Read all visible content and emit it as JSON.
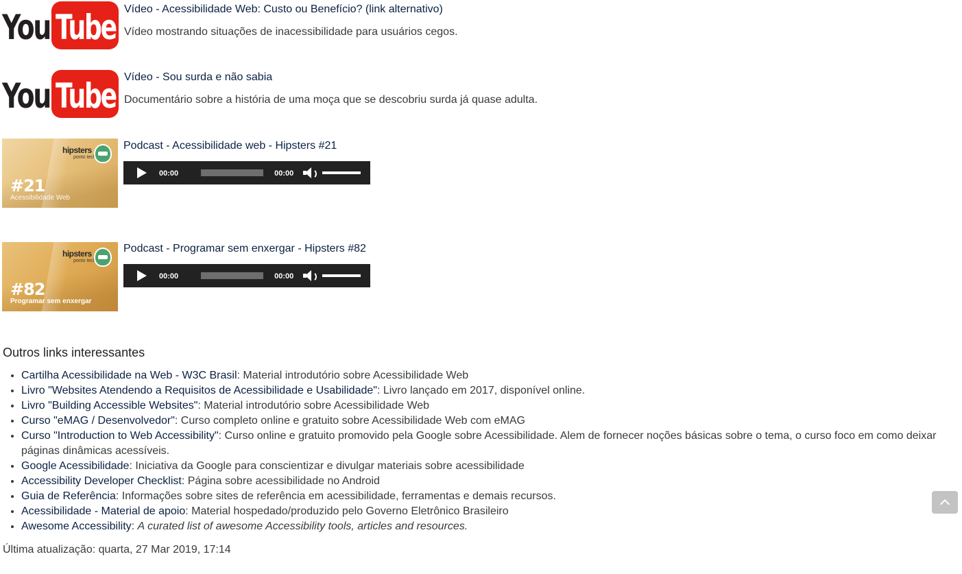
{
  "media": [
    {
      "type": "video",
      "thumb_icon": "youtube-logo",
      "title": "Vídeo - Acessibilidade Web: Custo ou Benefício? (link alternativo)",
      "description": "Vídeo mostrando situações de inacessibilidade para usuários cegos."
    },
    {
      "type": "video",
      "thumb_icon": "youtube-logo",
      "title": "Vídeo - Sou surda e não sabia",
      "description": "Documentário sobre a história de uma moça que se descobriu surda já quase adulta."
    },
    {
      "type": "podcast",
      "thumb_number": "#21",
      "thumb_subtitle": "Acessibilidade Web",
      "thumb_brand": "hipsters",
      "thumb_brand_sub": "ponto tech",
      "title": "Podcast - Acessibilidade web - Hipsters #21",
      "player": {
        "current_time": "00:00",
        "duration": "00:00"
      }
    },
    {
      "type": "podcast",
      "thumb_number": "#82",
      "thumb_subtitle": "Programar sem enxergar",
      "thumb_brand": "hipsters",
      "thumb_brand_sub": "ponto tech",
      "title": "Podcast - Programar sem enxergar - Hipsters #82",
      "player": {
        "current_time": "00:00",
        "duration": "00:00"
      }
    }
  ],
  "youtube_logo": {
    "word1": "You",
    "word2": "Tube",
    "red": "#e62117"
  },
  "links_section": {
    "heading": "Outros links interessantes",
    "items": [
      {
        "link": "Cartilha Acessibilidade na Web - W3C Brasil",
        "text": ": Material introdutório sobre Acessibilidade Web"
      },
      {
        "link": "Livro \"Websites Atendendo a Requisitos de Acessibilidade e Usabilidade\"",
        "text": ": Livro lançado em 2017, disponível online."
      },
      {
        "link": "Livro \"Building Accessible Websites\"",
        "text": ": Material introdutório sobre Acessibilidade Web"
      },
      {
        "link": "Curso \"eMAG / Desenvolvedor\"",
        "text": ": Curso completo online e gratuito sobre Acessibilidade Web com eMAG"
      },
      {
        "link": "Curso \"Introduction to Web Accessibility\"",
        "text": ": Curso online e gratuito promovido pela Google sobre Acessibilidade. Alem de fornecer noções básicas sobre o tema, o curso foco em como deixar páginas dinâmicas acessíveis."
      },
      {
        "link": "Google Acessibilidade",
        "text": ": Iniciativa da Google para conscientizar e divulgar materiais sobre acessibilidade"
      },
      {
        "link": "Accessibility Developer Checklist",
        "text": ": Página sobre acessibilidade no Android"
      },
      {
        "link": "Guia de Referência",
        "text": ": Informações sobre sites de referência em acessibilidade, ferramentas e demais recursos."
      },
      {
        "link": "Acessibilidade - Material de apoio",
        "text": ": Material hospedado/produzido pelo Governo Eletrônico Brasileiro"
      },
      {
        "link": "Awesome Accessibility",
        "text": ": ",
        "italic": "A curated list of awesome Accessibility tools, articles and resources."
      }
    ]
  },
  "footer": {
    "last_updated": "Última atualização: quarta, 27 Mar 2019, 17:14"
  },
  "colors": {
    "link": "#0a2142",
    "text": "#373a3c",
    "player_bg": "#222222",
    "back_to_top_bg": "#c3c3c3"
  }
}
